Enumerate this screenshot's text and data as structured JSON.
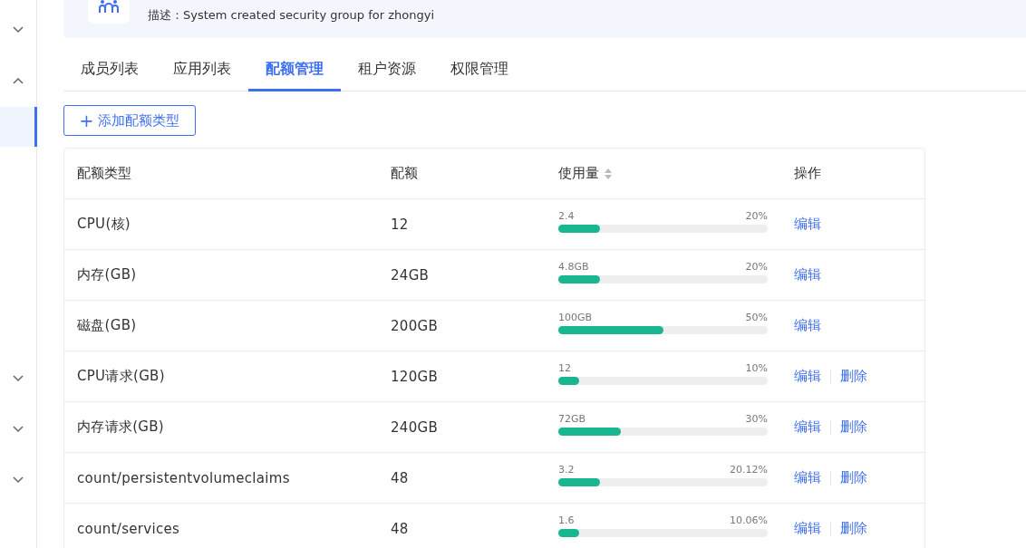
{
  "sidebar": {
    "items": [
      {
        "kind": "group",
        "expanded": false
      },
      {
        "kind": "group",
        "expanded": true
      },
      {
        "kind": "entry",
        "selected": true
      },
      {
        "kind": "group",
        "expanded": false
      },
      {
        "kind": "group",
        "expanded": false
      },
      {
        "kind": "group",
        "expanded": false
      }
    ]
  },
  "header": {
    "description": "描述：System created security group for zhongyi"
  },
  "tabs": [
    {
      "label": "成员列表",
      "selected": false
    },
    {
      "label": "应用列表",
      "selected": false
    },
    {
      "label": "配额管理",
      "selected": true
    },
    {
      "label": "租户资源",
      "selected": false
    },
    {
      "label": "权限管理",
      "selected": false
    }
  ],
  "add_button": {
    "icon": "+",
    "label": "添加配额类型"
  },
  "table": {
    "columns": [
      "配额类型",
      "配额",
      "使用量",
      "操作"
    ],
    "rows": [
      {
        "type": "CPU(核)",
        "quota": "12",
        "used": "2.4",
        "percent": "20%",
        "level": 0.2,
        "actions": [
          "编辑"
        ]
      },
      {
        "type": "内存(GB)",
        "quota": "24GB",
        "used": "4.8GB",
        "percent": "20%",
        "level": 0.2,
        "actions": [
          "编辑"
        ]
      },
      {
        "type": "磁盘(GB)",
        "quota": "200GB",
        "used": "100GB",
        "percent": "50%",
        "level": 0.5,
        "actions": [
          "编辑"
        ]
      },
      {
        "type": "CPU请求(GB)",
        "quota": "120GB",
        "used": "12",
        "percent": "10%",
        "level": 0.1,
        "actions": [
          "编辑",
          "删除"
        ]
      },
      {
        "type": "内存请求(GB)",
        "quota": "240GB",
        "used": "72GB",
        "percent": "30%",
        "level": 0.3,
        "actions": [
          "编辑",
          "删除"
        ]
      },
      {
        "type": "count/persistentvolumeclaims",
        "quota": "48",
        "used": "3.2",
        "percent": "20.12%",
        "level": 0.2012,
        "actions": [
          "编辑",
          "删除"
        ]
      },
      {
        "type": "count/services",
        "quota": "48",
        "used": "1.6",
        "percent": "10.06%",
        "level": 0.1006,
        "actions": [
          "编辑",
          "删除"
        ]
      }
    ]
  }
}
